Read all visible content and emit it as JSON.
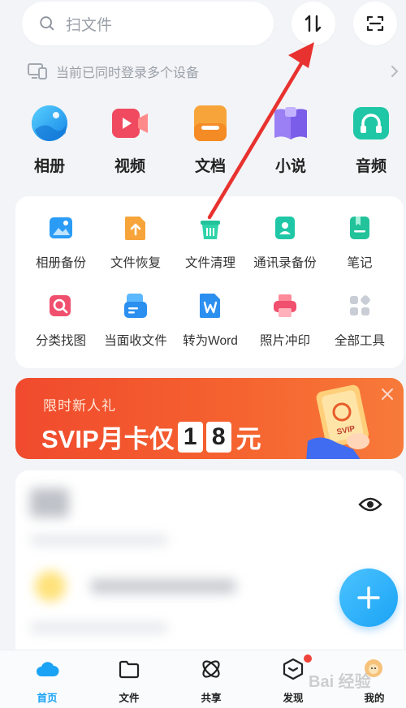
{
  "search": {
    "placeholder": "扫文件"
  },
  "devices": {
    "text": "当前已同时登录多个设备"
  },
  "categories": [
    {
      "label": "相册",
      "icon": "photo-album-icon",
      "color": "#1ea5f5"
    },
    {
      "label": "视频",
      "icon": "video-icon",
      "color": "#f04a60"
    },
    {
      "label": "文档",
      "icon": "document-icon",
      "color": "#f7a53a"
    },
    {
      "label": "小说",
      "icon": "novel-icon",
      "color": "#8a6df2"
    },
    {
      "label": "音频",
      "icon": "audio-icon",
      "color": "#1fc7a6"
    }
  ],
  "tools": {
    "row1": [
      {
        "label": "相册备份",
        "icon": "album-backup-icon"
      },
      {
        "label": "文件恢复",
        "icon": "file-restore-icon"
      },
      {
        "label": "文件清理",
        "icon": "file-cleanup-icon"
      },
      {
        "label": "通讯录备份",
        "icon": "contacts-backup-icon"
      },
      {
        "label": "笔记",
        "icon": "notes-icon"
      }
    ],
    "row2": [
      {
        "label": "分类找图",
        "icon": "image-search-icon"
      },
      {
        "label": "当面收文件",
        "icon": "receive-file-icon"
      },
      {
        "label": "转为Word",
        "icon": "convert-word-icon"
      },
      {
        "label": "照片冲印",
        "icon": "photo-print-icon"
      },
      {
        "label": "全部工具",
        "icon": "all-tools-icon"
      }
    ]
  },
  "banner": {
    "subtitle": "限时新人礼",
    "title_prefix": "SVIP月卡仅",
    "digit1": "1",
    "digit2": "8",
    "title_suffix": "元",
    "art_text": "SVIP"
  },
  "nav": {
    "items": [
      {
        "label": "首页",
        "icon": "home-cloud-icon",
        "active": true
      },
      {
        "label": "文件",
        "icon": "folder-icon"
      },
      {
        "label": "共享",
        "icon": "share-icon"
      },
      {
        "label": "发现",
        "icon": "discover-icon"
      },
      {
        "label": "我的",
        "icon": "profile-icon"
      }
    ]
  },
  "watermark": "Bai 经验",
  "colors": {
    "accent": "#1aa3f5",
    "banner": "#f04a2e",
    "annotation": "#e8322f"
  }
}
